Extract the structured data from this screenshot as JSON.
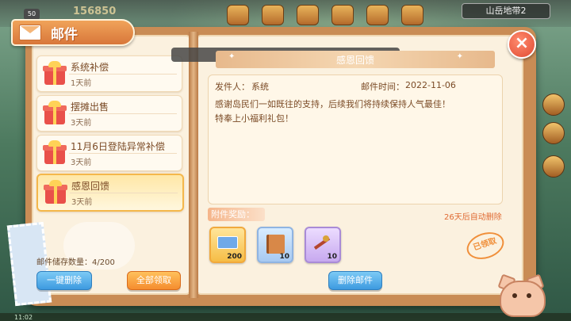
{
  "header": {
    "title": "邮件",
    "close": "×"
  },
  "background": {
    "score": "156850",
    "level": "50",
    "region": "山岳地带2",
    "time": "11:02"
  },
  "mail_list": [
    {
      "title": "系统补偿",
      "date": "1天前",
      "selected": false
    },
    {
      "title": "摆摊出售",
      "date": "3天前",
      "selected": false
    },
    {
      "title": "11月6日登陆异常补偿",
      "date": "3天前",
      "selected": false
    },
    {
      "title": "感恩回馈",
      "date": "3天前",
      "selected": true
    }
  ],
  "left_footer": {
    "storage": "邮件储存数量：4/200",
    "delete_all": "一键删除",
    "claim_all": "全部领取"
  },
  "detail": {
    "subject": "感恩回馈",
    "sender_label": "发件人：",
    "sender": "系统",
    "time_label": "邮件时间：",
    "time": "2022-11-06",
    "body": "感谢岛民们一如既往的支持，后续我们将持续保持人气最佳！特奉上小福利礼包！",
    "attach_label": "附件奖励：",
    "expire": "26天后自动删除",
    "claimed": "已领取",
    "delete_button": "删除邮件"
  },
  "rewards": [
    {
      "name": "ticket",
      "count": "200",
      "color": "#f6bd46"
    },
    {
      "name": "book",
      "count": "10",
      "color": "#a7c9f1"
    },
    {
      "name": "key",
      "count": "10",
      "color": "#c7a9ef"
    }
  ]
}
